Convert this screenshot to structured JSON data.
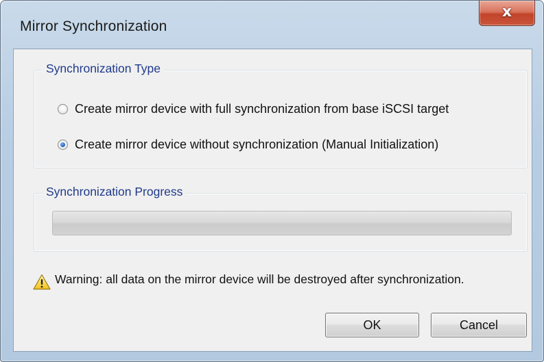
{
  "window": {
    "title": "Mirror Synchronization",
    "close_label": "x"
  },
  "sync_type": {
    "legend": "Synchronization Type",
    "options": [
      {
        "label": "Create mirror device with full synchronization from base iSCSI target",
        "selected": false
      },
      {
        "label": "Create mirror device without synchronization (Manual Initialization)",
        "selected": true
      }
    ]
  },
  "sync_progress": {
    "legend": "Synchronization Progress",
    "progress_fraction": 0
  },
  "warning": {
    "icon": "warning-triangle-icon",
    "text": "Warning: all data on the mirror device will be destroyed after synchronization."
  },
  "buttons": {
    "ok_label": "OK",
    "cancel_label": "Cancel"
  }
}
